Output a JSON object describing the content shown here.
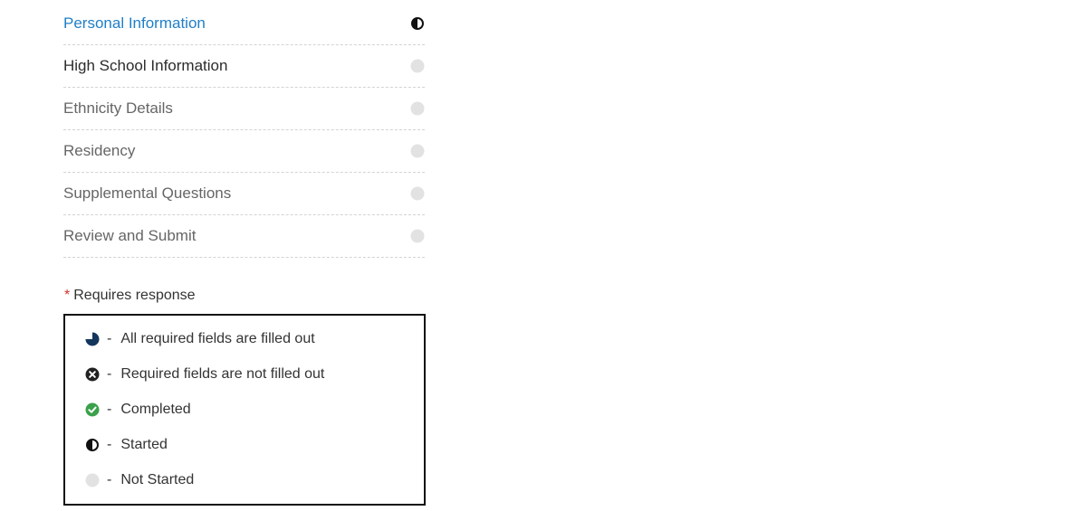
{
  "nav": {
    "items": [
      {
        "label": "Personal Information",
        "status": "started-icon"
      },
      {
        "label": "High School Information",
        "status": "not-started-icon"
      },
      {
        "label": "Ethnicity Details",
        "status": "not-started-icon"
      },
      {
        "label": "Residency",
        "status": "not-started-icon"
      },
      {
        "label": "Supplemental Questions",
        "status": "not-started-icon"
      },
      {
        "label": "Review and Submit",
        "status": "not-started-icon"
      }
    ]
  },
  "note": {
    "star": "*",
    "text": "Requires response"
  },
  "legend": {
    "separator": "-",
    "items": [
      {
        "icon": "all-required-filled-icon",
        "text": "All required fields are filled out"
      },
      {
        "icon": "required-not-filled-icon",
        "text": "Required fields are not filled out"
      },
      {
        "icon": "completed-icon",
        "text": "Completed"
      },
      {
        "icon": "started-icon",
        "text": "Started"
      },
      {
        "icon": "not-started-icon",
        "text": "Not Started"
      }
    ]
  },
  "colors": {
    "active_link": "#1f7fc7",
    "required_star": "#d0312d",
    "navy": "#14365c",
    "green": "#3aa14a",
    "grey_dot": "#e2e2e2"
  }
}
